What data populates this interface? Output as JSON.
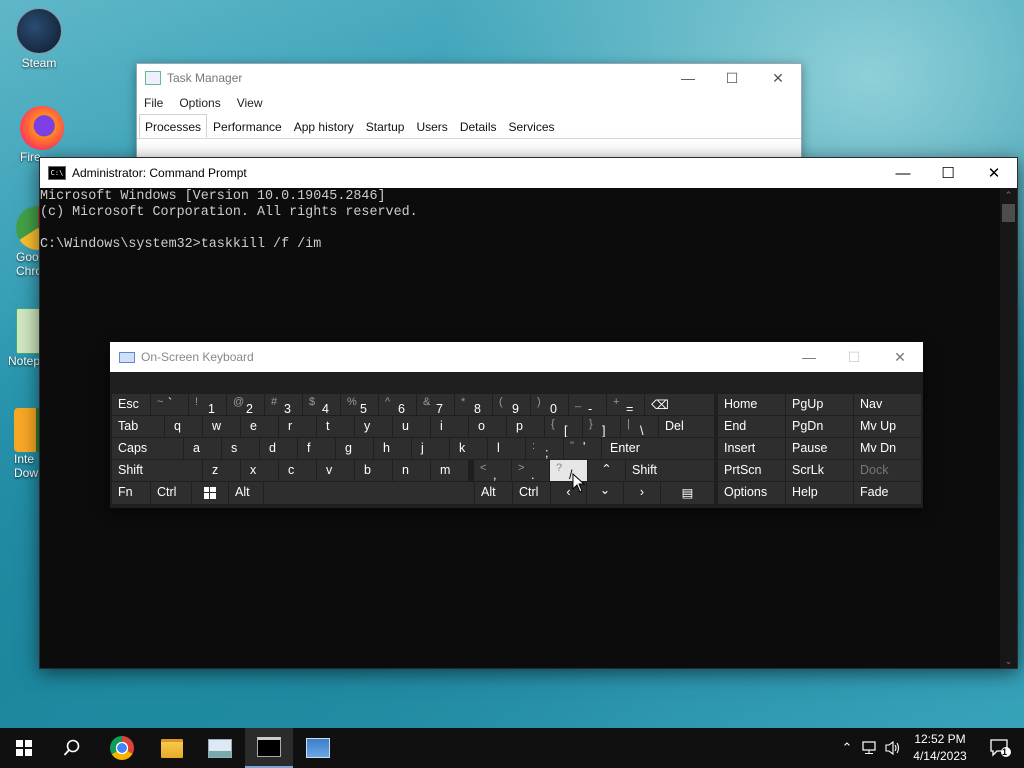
{
  "desktop": {
    "icons": [
      "Steam",
      "Fire",
      "Goo Chro",
      "Notep",
      "Inte Dow"
    ]
  },
  "task_manager": {
    "title": "Task Manager",
    "menu": [
      "File",
      "Options",
      "View"
    ],
    "tabs": [
      "Processes",
      "Performance",
      "App history",
      "Startup",
      "Users",
      "Details",
      "Services"
    ],
    "active_tab": "Processes"
  },
  "cmd": {
    "title": "Administrator: Command Prompt",
    "lines": [
      "Microsoft Windows [Version 10.0.19045.2846]",
      "(c) Microsoft Corporation. All rights reserved.",
      "",
      "C:\\Windows\\system32>taskkill /f /im"
    ]
  },
  "osk": {
    "title": "On-Screen Keyboard",
    "row1": {
      "esc": "Esc",
      "keys": [
        {
          "shift": "~",
          "main": "`"
        },
        {
          "shift": "!",
          "main": "1"
        },
        {
          "shift": "@",
          "main": "2"
        },
        {
          "shift": "#",
          "main": "3"
        },
        {
          "shift": "$",
          "main": "4"
        },
        {
          "shift": "%",
          "main": "5"
        },
        {
          "shift": "^",
          "main": "6"
        },
        {
          "shift": "&",
          "main": "7"
        },
        {
          "shift": "*",
          "main": "8"
        },
        {
          "shift": "(",
          "main": "9"
        },
        {
          "shift": ")",
          "main": "0"
        },
        {
          "shift": "_",
          "main": "-"
        },
        {
          "shift": "+",
          "main": "="
        }
      ]
    },
    "row2": {
      "tab": "Tab",
      "letters": [
        "q",
        "w",
        "e",
        "r",
        "t",
        "y",
        "u",
        "i",
        "o",
        "p"
      ],
      "brackets": [
        {
          "shift": "{",
          "main": "["
        },
        {
          "shift": "}",
          "main": "]"
        },
        {
          "shift": "|",
          "main": "\\"
        }
      ],
      "del": "Del"
    },
    "row3": {
      "caps": "Caps",
      "letters": [
        "a",
        "s",
        "d",
        "f",
        "g",
        "h",
        "j",
        "k",
        "l"
      ],
      "punct": [
        {
          "shift": ":",
          "main": ";"
        },
        {
          "shift": "\"",
          "main": "'"
        }
      ],
      "enter": "Enter"
    },
    "row4": {
      "shift_left": "Shift",
      "letters": [
        "z",
        "x",
        "c",
        "v",
        "b",
        "n",
        "m"
      ],
      "punct": [
        {
          "shift": "<",
          "main": ","
        },
        {
          "shift": ">",
          "main": "."
        },
        {
          "shift": "?",
          "main": "/"
        }
      ],
      "shift_right": "Shift"
    },
    "row5": {
      "fn": "Fn",
      "ctrl_left": "Ctrl",
      "alt_left": "Alt",
      "alt_right": "Alt",
      "ctrl_right": "Ctrl"
    },
    "nav": [
      [
        "Home",
        "PgUp",
        "Nav"
      ],
      [
        "End",
        "PgDn",
        "Mv Up"
      ],
      [
        "Insert",
        "Pause",
        "Mv Dn"
      ],
      [
        "PrtScn",
        "ScrLk",
        "Dock"
      ],
      [
        "Options",
        "Help",
        "Fade"
      ]
    ]
  },
  "taskbar": {
    "time": "12:52 PM",
    "date": "4/14/2023",
    "notification_count": "1"
  }
}
